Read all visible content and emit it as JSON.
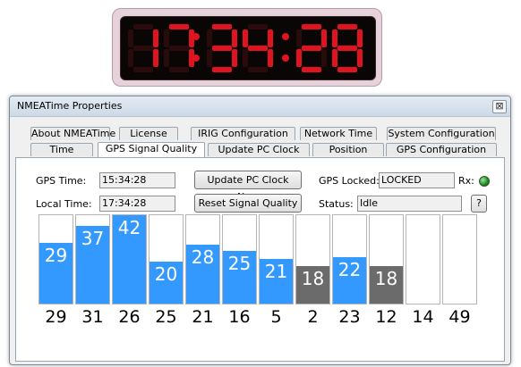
{
  "clock": {
    "time_text": "17:34:28",
    "digits": [
      "1",
      "7",
      "3",
      "4",
      "2",
      "8"
    ],
    "led_color": "#e0141e",
    "led_off_color": "#2a0b0c"
  },
  "window": {
    "title": "NMEATime Properties",
    "close_glyph": "⊠"
  },
  "tabs_row1": [
    "About NMEATime",
    "License",
    "IRIG Configuration",
    "Network Time",
    "System Configuration"
  ],
  "tabs_row2": [
    "Time",
    "GPS Signal Quality",
    "Update PC Clock",
    "Position",
    "GPS Configuration"
  ],
  "active_tab": "GPS Signal Quality",
  "gps_time": {
    "label": "GPS Time:",
    "value": "15:34:28"
  },
  "local_time": {
    "label": "Local Time:",
    "value": "17:34:28"
  },
  "buttons": {
    "update_pc_clock": "Update PC Clock Now",
    "reset_signal": "Reset Signal Quality",
    "help": "?"
  },
  "gps_locked": {
    "label": "GPS Locked:",
    "value": "LOCKED"
  },
  "rx": {
    "label": "Rx:",
    "led_color": "#1c8a1c"
  },
  "status": {
    "label": "Status:",
    "value": "Idle"
  },
  "signal_scale_max": 42,
  "satellites": [
    {
      "prn": "29",
      "snr": 29,
      "color": "#3399ff",
      "label": "29"
    },
    {
      "prn": "31",
      "snr": 37,
      "color": "#3399ff",
      "label": "37"
    },
    {
      "prn": "26",
      "snr": 42,
      "color": "#3399ff",
      "label": "42"
    },
    {
      "prn": "25",
      "snr": 20,
      "color": "#3399ff",
      "label": "20"
    },
    {
      "prn": "21",
      "snr": 28,
      "color": "#3399ff",
      "label": "28"
    },
    {
      "prn": "16",
      "snr": 25,
      "color": "#3399ff",
      "label": "25"
    },
    {
      "prn": "5",
      "snr": 21,
      "color": "#3399ff",
      "label": "21"
    },
    {
      "prn": "2",
      "snr": 18,
      "color": "#6b6b6b",
      "label": "18"
    },
    {
      "prn": "23",
      "snr": 22,
      "color": "#3399ff",
      "label": "22"
    },
    {
      "prn": "12",
      "snr": 18,
      "color": "#6b6b6b",
      "label": "18"
    },
    {
      "prn": "14",
      "snr": 0,
      "color": "#3399ff",
      "label": ""
    },
    {
      "prn": "49",
      "snr": 0,
      "color": "#3399ff",
      "label": ""
    }
  ]
}
